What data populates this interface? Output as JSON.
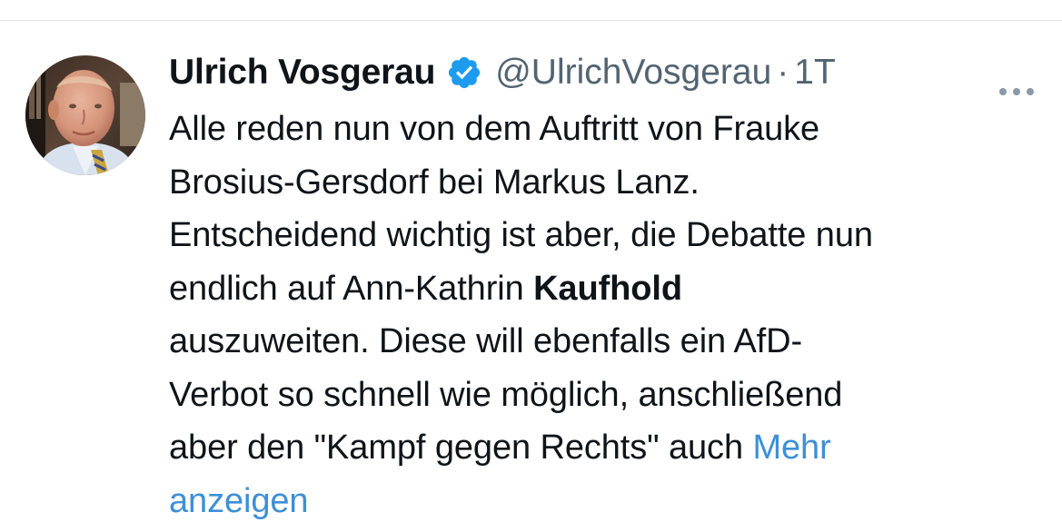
{
  "tweet": {
    "author": {
      "display_name": "Ulrich Vosgerau",
      "handle": "@UlrichVosgerau",
      "verified": true,
      "avatar": "avatar"
    },
    "separator": "·",
    "timestamp": "1T",
    "text_before_bold": "Alle reden nun von dem Auftritt von Frauke\nBrosius-Gersdorf bei Markus Lanz.\nEntscheidend wichtig ist aber, die Debatte nun\nendlich auf Ann-Kathrin ",
    "text_bold": "Kaufhold",
    "text_after_bold": "\nauszuweiten. Diese will ebenfalls ein AfD-\nVerbot so schnell wie möglich, anschließend\naber den \"Kampf gegen Rechts\" auch ",
    "show_more_label": "Mehr\nanzeigen",
    "icons": {
      "verified": "verified-badge-icon",
      "more": "more-options-icon"
    },
    "colors": {
      "verified": "#1d9bf0",
      "link": "#3d8fd8",
      "secondary_text": "#536471"
    }
  }
}
